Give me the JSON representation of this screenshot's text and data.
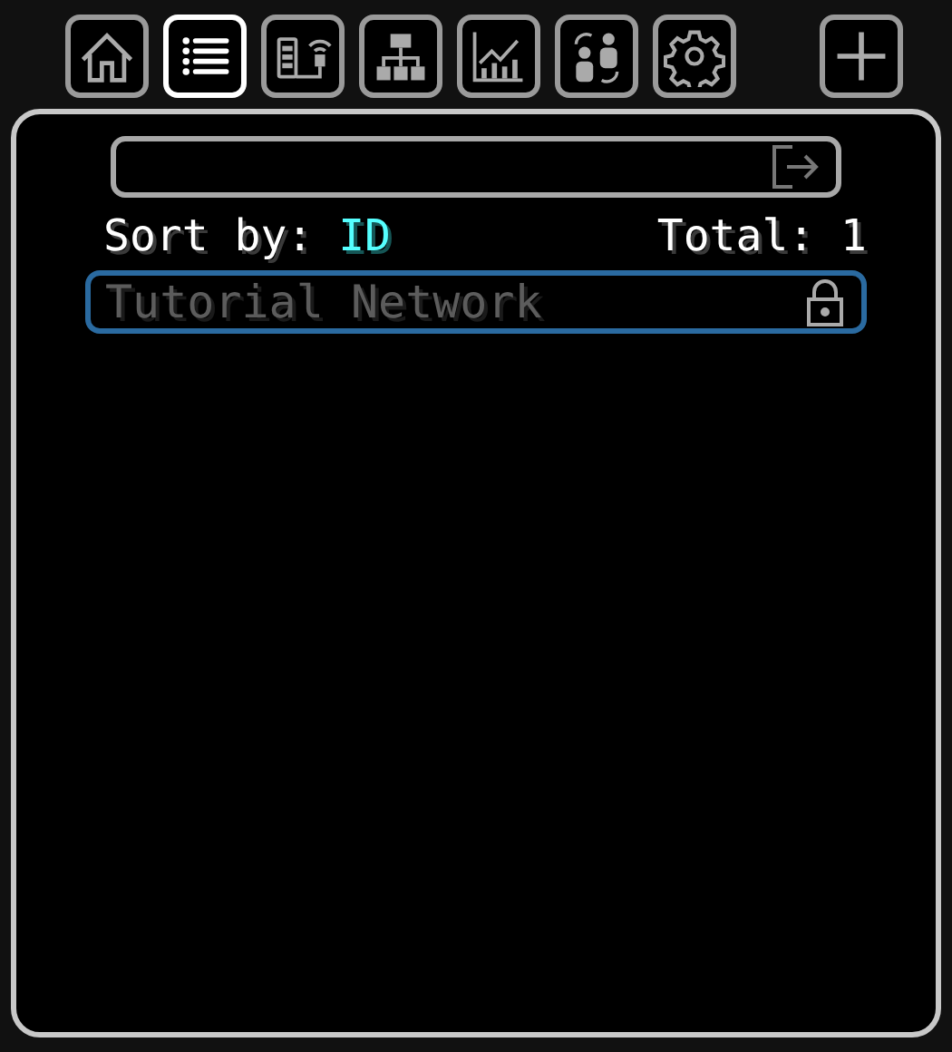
{
  "tabs": [
    {
      "kind": "home",
      "selected": false
    },
    {
      "kind": "list",
      "selected": true
    },
    {
      "kind": "connections",
      "selected": false
    },
    {
      "kind": "hierarchy",
      "selected": false
    },
    {
      "kind": "statistics",
      "selected": false
    },
    {
      "kind": "members",
      "selected": false
    },
    {
      "kind": "settings",
      "selected": false
    }
  ],
  "add_button": {
    "kind": "plus"
  },
  "sort": {
    "label": "Sort by:",
    "value": "ID"
  },
  "total": "Total: 1",
  "networks": [
    {
      "name": "Tutorial Network",
      "color": "#2a6aa0",
      "locked": true
    }
  ]
}
